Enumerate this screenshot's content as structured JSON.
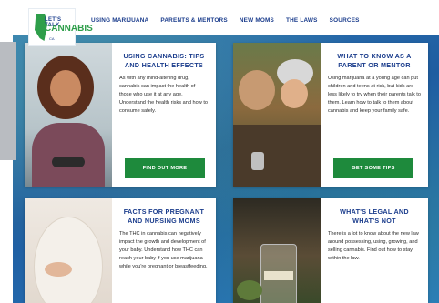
{
  "header": {
    "logo": {
      "line1": "LET'S TALK",
      "line2": "CANNABIS",
      "line3": "CA"
    },
    "nav": [
      "USING MARIJUANA",
      "PARENTS & MENTORS",
      "NEW MOMS",
      "THE LAWS",
      "SOURCES"
    ]
  },
  "cards": [
    {
      "title": "USING CANNABIS: TIPS AND HEALTH EFFECTS",
      "text": "As with any mind-altering drug, cannabis can impact the health of those who use it at any age. Understand the health risks and how to consume safely.",
      "button": "FIND OUT MORE"
    },
    {
      "title": "WHAT TO KNOW AS A PARENT OR MENTOR",
      "text": "Using marijuana at a young age can put children and teens at risk, but kids are less likely to try when their parents talk to them. Learn how to talk to them about cannabis and keep your family safe.",
      "button": "GET SOME TIPS"
    },
    {
      "title": "FACTS FOR PREGNANT AND NURSING MOMS",
      "text": "The THC in cannabis can negatively impact the growth and development of your baby. Understand how THC can reach your baby if you use marijuana while you're pregnant or breastfeeding."
    },
    {
      "title": "WHAT'S LEGAL AND WHAT'S NOT",
      "text": "There is a lot to know about the new law around possessing, using, growing, and selling cannabis. Find out how to stay within the law."
    }
  ]
}
